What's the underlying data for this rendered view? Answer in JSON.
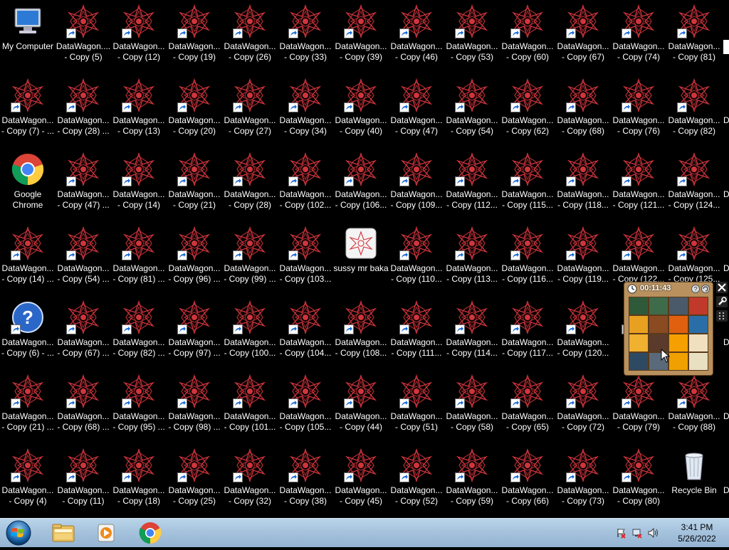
{
  "desktop": {
    "rows": [
      [
        "My Computer",
        "DataWagon....\n- Copy (5)",
        "DataWagon...\n- Copy (12)",
        "DataWagon...\n- Copy (19)",
        "DataWagon...\n- Copy (26)",
        "DataWagon...\n- Copy (33)",
        "DataWagon...\n- Copy (39)",
        "DataWagon...\n- Copy (46)",
        "DataWagon...\n- Copy (53)",
        "DataWagon...\n- Copy (60)",
        "DataWagon...\n- Copy (67)",
        "DataWagon...\n- Copy (74)",
        "DataWagon...\n- Copy (81)"
      ],
      [
        "DataWagon...\n- Copy (7) - ...",
        "DataWagon...\n- Copy (28) ...",
        "DataWagon...\n- Copy (13)",
        "DataWagon...\n- Copy (20)",
        "DataWagon...\n- Copy (27)",
        "DataWagon...\n- Copy (34)",
        "DataWagon...\n- Copy (40)",
        "DataWagon...\n- Copy (47)",
        "DataWagon...\n- Copy (54)",
        "DataWagon...\n- Copy (62)",
        "DataWagon...\n- Copy (68)",
        "DataWagon...\n- Copy (76)",
        "DataWagon...\n- Copy (82)"
      ],
      [
        "Google\nChrome",
        "DataWagon...\n- Copy (47) ...",
        "DataWagon...\n- Copy (14)",
        "DataWagon...\n- Copy (21)",
        "DataWagon...\n- Copy (28)",
        "DataWagon...\n- Copy (102...",
        "DataWagon...\n- Copy (106...",
        "DataWagon...\n- Copy (109...",
        "DataWagon...\n- Copy (112...",
        "DataWagon...\n- Copy (115...",
        "DataWagon...\n- Copy (118...",
        "DataWagon...\n- Copy (121...",
        "DataWagon...\n- Copy (124..."
      ],
      [
        "DataWagon...\n- Copy (14) ...",
        "DataWagon...\n- Copy (54) ...",
        "DataWagon...\n- Copy (81) ...",
        "DataWagon...\n- Copy (96) ...",
        "DataWagon...\n- Copy (99) ...",
        "DataWagon...\n- Copy (103...",
        "sussy mr baka",
        "DataWagon...\n- Copy (110...",
        "DataWagon...\n- Copy (113...",
        "DataWagon...\n- Copy (116...",
        "DataWagon...\n- Copy (119...",
        "DataWagon...\n- Copy (122...",
        "DataWagon...\n- Copy (125..."
      ],
      [
        "DataWagon...\n- Copy (6) - ...",
        "DataWagon...\n- Copy (67) ...",
        "DataWagon...\n- Copy (82) ...",
        "DataWagon...\n- Copy (97) ...",
        "DataWagon...\n- Copy (100...",
        "DataWagon...\n- Copy (104...",
        "DataWagon...\n- Copy (108...",
        "DataWagon...\n- Copy (111...",
        "DataWagon...\n- Copy (114...",
        "DataWagon...\n- Copy (117...",
        "DataWagon...\n- Copy (120...",
        "Dat",
        ""
      ],
      [
        "DataWagon...\n- Copy (21) ...",
        "DataWagon...\n- Copy (68) ...",
        "DataWagon...\n- Copy (95) ...",
        "DataWagon...\n- Copy (98) ...",
        "DataWagon...\n- Copy (101...",
        "DataWagon...\n- Copy (105...",
        "DataWagon...\n- Copy (44)",
        "DataWagon...\n- Copy (51)",
        "DataWagon...\n- Copy (58)",
        "DataWagon...\n- Copy (65)",
        "DataWagon...\n- Copy (72)",
        "DataWagon...\n- Copy (79)",
        "DataWagon...\n- Copy (88)"
      ],
      [
        "DataWagon...\n- Copy (4)",
        "DataWagon...\n- Copy (11)",
        "DataWagon...\n- Copy (18)",
        "DataWagon...\n- Copy (25)",
        "DataWagon...\n- Copy (32)",
        "DataWagon...\n- Copy (38)",
        "DataWagon...\n- Copy (45)",
        "DataWagon...\n- Copy (52)",
        "DataWagon...\n- Copy (59)",
        "DataWagon...\n- Copy (66)",
        "DataWagon...\n- Copy (73)",
        "DataWagon...\n- Copy (80)",
        "Recycle Bin"
      ]
    ],
    "right_edge_letters": [
      "D",
      "D",
      "D",
      "D",
      "D",
      "D",
      "D"
    ],
    "special_icons": {
      "My Computer": "computer-icon",
      "Google\nChrome": "chrome-icon",
      "sussy mr baka": "app-icon",
      "DataWagon...\n- Copy (6) - ...": "help-icon",
      "Recycle Bin": "recycle-bin-icon"
    }
  },
  "gadget": {
    "timer": "00:11:43",
    "tiles": [
      "#2f5a3a",
      "#3e6b4a",
      "#4a5a6a",
      "#c0392b",
      "#e8a020",
      "#8a4a22",
      "#e06010",
      "#2a6ea8",
      "#f0b030",
      "#5a3a2a",
      "#f5a000",
      "#f0e0c0",
      "#2e4a62",
      "#5a6a7a",
      "#f0a000",
      "#e8e0c0"
    ]
  },
  "taskbar": {
    "items": [
      "explorer-icon",
      "media-player-icon",
      "chrome-icon"
    ],
    "clock_time": "3:41 PM",
    "clock_date": "5/26/2022"
  },
  "colors": {
    "taskbar_top": "#b9d4ea",
    "taskbar_bottom": "#93b3d2",
    "datawagon_red": "#d0343c",
    "text": "#ffffff"
  }
}
